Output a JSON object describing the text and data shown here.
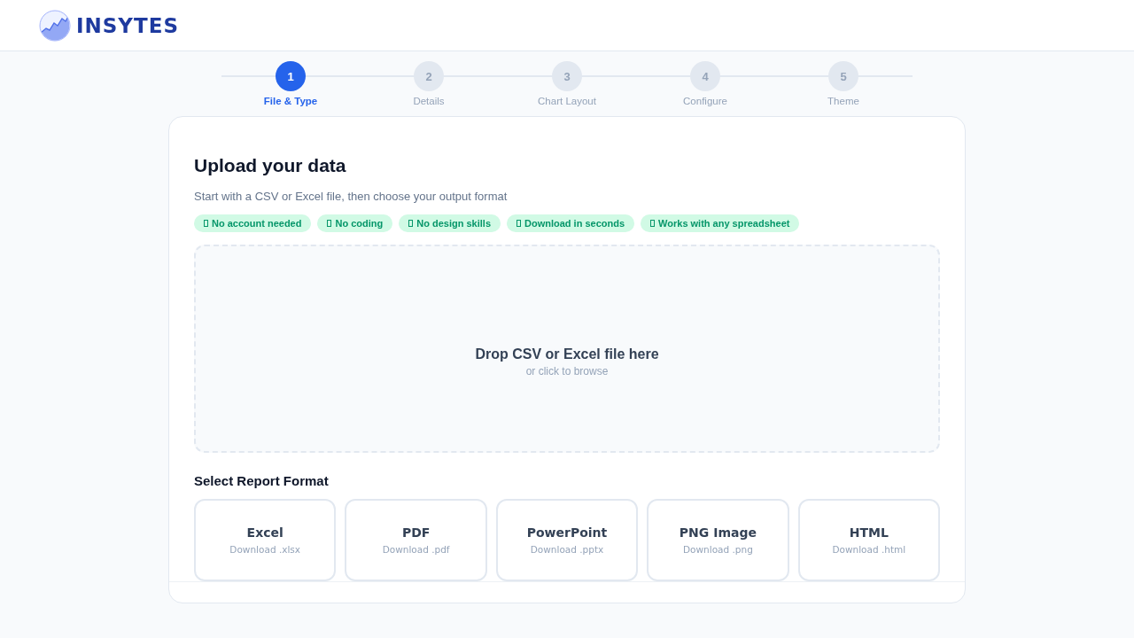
{
  "header": {
    "logo_text": "INSYTES"
  },
  "steps": [
    {
      "number": "1",
      "label": "File & Type",
      "selected": true
    },
    {
      "number": "2",
      "label": "Details",
      "selected": false
    },
    {
      "number": "3",
      "label": "Chart Layout",
      "selected": false
    },
    {
      "number": "4",
      "label": "Configure",
      "selected": false
    },
    {
      "number": "5",
      "label": "Theme",
      "selected": false
    }
  ],
  "upload": {
    "title": "Upload your data",
    "subtitle": "Start with a CSV or Excel file, then choose your output format",
    "badges": [
      "No account needed",
      "No coding",
      "No design skills",
      "Download in seconds",
      "Works with any spreadsheet"
    ],
    "dropzone": {
      "title": "Drop CSV or Excel file here",
      "hint": "or click to browse"
    }
  },
  "formats": {
    "heading": "Select Report Format",
    "options": [
      {
        "name": "Excel",
        "note": "Download .xlsx",
        "selected": false
      },
      {
        "name": "PDF",
        "note": "Download .pdf",
        "selected": false
      },
      {
        "name": "PowerPoint",
        "note": "Download .pptx",
        "selected": false
      },
      {
        "name": "PNG Image",
        "note": "Download .png",
        "selected": false
      },
      {
        "name": "HTML",
        "note": "Download .html",
        "selected": false
      }
    ]
  }
}
